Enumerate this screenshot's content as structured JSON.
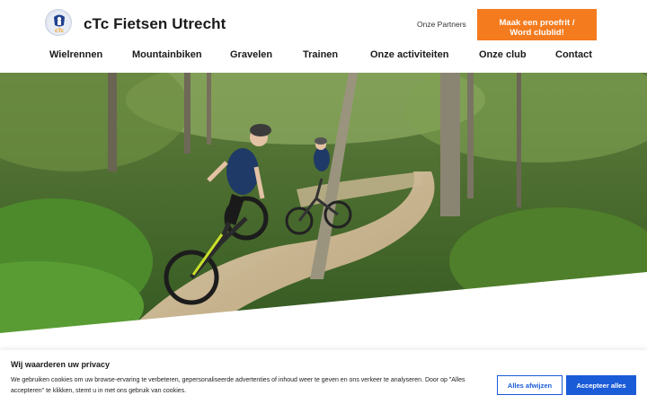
{
  "header": {
    "brand_name": "cTc Fietsen Utrecht",
    "logo_text": "cTc",
    "partners_link": "Onze Partners",
    "cta_line1": "Maak een proefrit /",
    "cta_line2": "Word clublid!"
  },
  "nav": {
    "items": [
      {
        "label": "Wielrennen"
      },
      {
        "label": "Mountainbiken"
      },
      {
        "label": "Gravelen"
      },
      {
        "label": "Trainen"
      },
      {
        "label": "Onze activiteiten"
      },
      {
        "label": "Onze club"
      },
      {
        "label": "Contact"
      }
    ]
  },
  "hero": {
    "icon": "mountain-bikers-forest-photo"
  },
  "cookie_banner": {
    "title": "Wij waarderen uw privacy",
    "text": "We gebruiken cookies om uw browse-ervaring te verbeteren, gepersonaliseerde advertenties of inhoud weer te geven en ons verkeer te analyseren. Door op \"Alles accepteren\" te klikken, stemt u in met ons gebruik van cookies.",
    "reject_label": "Alles afwijzen",
    "accept_label": "Accepteer alles"
  },
  "colors": {
    "cta_orange": "#f47b1e",
    "accept_blue": "#1a5bd8",
    "text_dark": "#1a1a1a"
  }
}
